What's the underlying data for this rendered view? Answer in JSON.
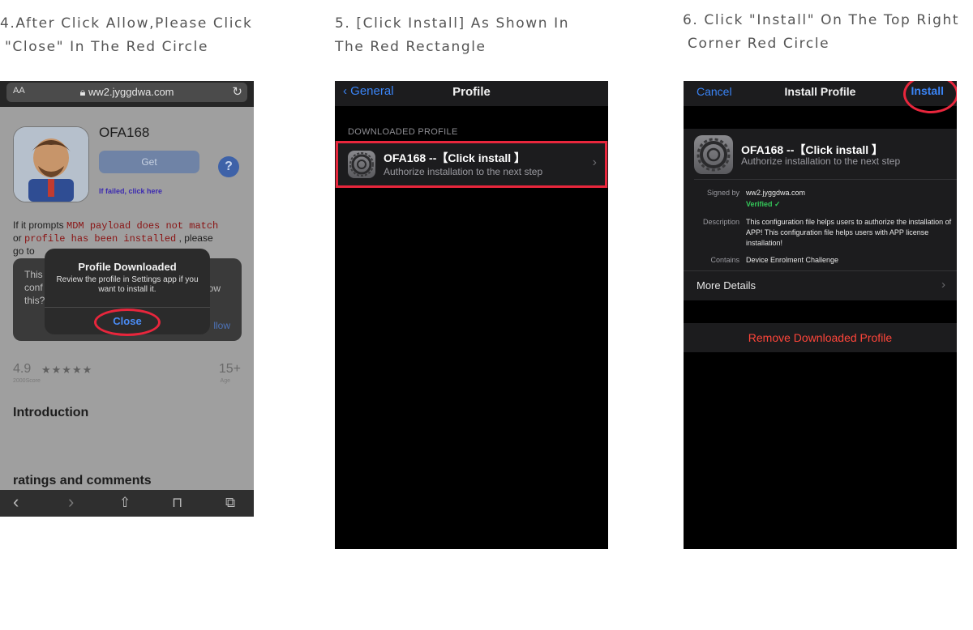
{
  "captions": {
    "step4_line1": "4.After Click Allow,Please Click",
    "step4_line2": "\"Close\" In The Red Circle",
    "step5_line1": "5. [Click Install] As Shown In",
    "step5_line2": "The Red Rectangle",
    "step6_line1": "6. Click \"Install\" On The Top Right",
    "step6_line2": "Corner Red Circle"
  },
  "safari": {
    "text_size": "AA",
    "url": "ww2.jyggdwa.com",
    "app_name": "OFA168",
    "get_label": "Get",
    "failed_link": "If failed, click here",
    "help_glyph": "?",
    "prompt_pre": "If it prompts",
    "prompt_code1": "MDM payload does not match",
    "prompt_or": "or",
    "prompt_code2": "profile has been installed",
    "prompt_post": ", please",
    "prompt_goto": "go to",
    "bg_dialog_text": "This\nconf\nthis?",
    "bg_dialog_allow_partial": "ow",
    "bg_dialog_allow": "llow",
    "alert_title": "Profile Downloaded",
    "alert_message": "Review the profile in Settings app if you want to install it.",
    "alert_close": "Close",
    "rating": "4.9",
    "stars": "★★★★★",
    "score_count": "2000Score",
    "age": "15+",
    "age_label": "Age",
    "introduction": "Introduction",
    "ratings_comments": "ratings and comments",
    "toolbar": {
      "back": "‹",
      "forward": "›",
      "share": "⇧",
      "bookmarks": "⊓",
      "tabs": "⧉"
    }
  },
  "settings_profile": {
    "back_label": "General",
    "title": "Profile",
    "section_header": "DOWNLOADED PROFILE",
    "row_title": "OFA168 --【Click install 】",
    "row_subtitle": "Authorize installation to the next step"
  },
  "install_profile": {
    "cancel": "Cancel",
    "title": "Install Profile",
    "install": "Install",
    "profile_title": "OFA168 --【Click install 】",
    "profile_subtitle": "Authorize installation to the next step",
    "signed_by_label": "Signed by",
    "signed_by_value": "ww2.jyggdwa.com",
    "verified": "Verified ✓",
    "description_label": "Description",
    "description_value": "This configuration file helps users to authorize the installation of APP!   This configuration file helps users with APP license installation!",
    "contains_label": "Contains",
    "contains_value": "Device Enrolment Challenge",
    "more_details": "More Details",
    "remove": "Remove Downloaded Profile"
  },
  "colors": {
    "accent_blue": "#3a84f6",
    "highlight_red": "#e8263c",
    "destructive": "#ff453a",
    "verified_green": "#34c759"
  }
}
